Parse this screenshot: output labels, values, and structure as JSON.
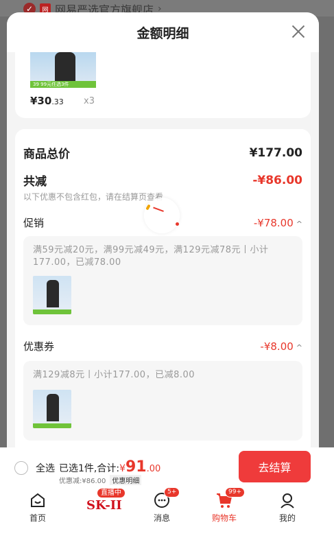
{
  "store": {
    "name": "网易严选官方旗舰店",
    "logo_text": "网",
    "chevron": "›"
  },
  "sheet": {
    "title": "金额明细"
  },
  "product": {
    "price_main": "¥30",
    "price_dec": ".33",
    "qty": "x3",
    "thumb_badge": "39",
    "thumb_strip": "99元任选3件"
  },
  "summary": {
    "goods_total_label": "商品总价",
    "goods_total_value": "¥177.00",
    "reduce_label": "共减",
    "reduce_value": "-¥86.00",
    "reduce_note": "以下优惠不包含红包，请在结算页查看"
  },
  "promotion": {
    "label": "促销",
    "value": "-¥78.00",
    "detail": "满59元减20元，满99元减49元，满129元减78元丨小计177.00，已减78.00"
  },
  "coupon": {
    "label": "优惠券",
    "value": "-¥8.00",
    "detail": "满129减8元丨小计177.00，已减8.00"
  },
  "cart_bar": {
    "select_all": "全选",
    "selected_text": "已选1件,合计:",
    "currency": "¥",
    "total_int": "91",
    "total_dec": ".00",
    "discount_text": "优惠减:¥86.00",
    "discount_detail": "优惠明细",
    "checkout": "去结算"
  },
  "tabs": {
    "home": "首页",
    "live_badge": "直播中",
    "brand": "SK-II",
    "messages": "消息",
    "messages_badge": "5+",
    "cart": "购物车",
    "cart_badge": "99+",
    "mine": "我的"
  },
  "colors": {
    "accent": "#e8372b",
    "checkout_bg": "#ef3b3b",
    "overlay": "#6f6f6f"
  }
}
